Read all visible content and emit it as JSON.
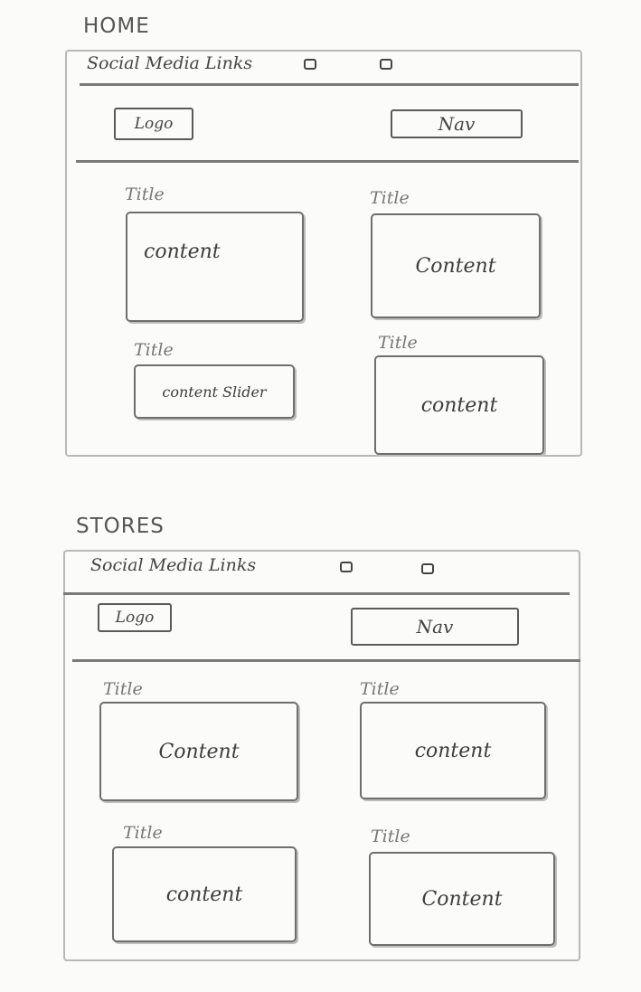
{
  "home": {
    "page_label": "HOME",
    "social_text": "Social Media Links",
    "social_icons": [
      "square-icon",
      "square-icon"
    ],
    "logo": "Logo",
    "nav": "Nav",
    "blocks": [
      {
        "title": "Title",
        "content": "content"
      },
      {
        "title": "Title",
        "content": "Content"
      },
      {
        "title": "Title",
        "content": "content Slider"
      },
      {
        "title": "Title",
        "content": "content"
      }
    ]
  },
  "stores": {
    "page_label": "STORES",
    "social_text": "Social Media Links",
    "social_icons": [
      "square-icon",
      "square-icon"
    ],
    "logo": "Logo",
    "nav": "Nav",
    "blocks": [
      {
        "title": "Title",
        "content": "Content"
      },
      {
        "title": "Title",
        "content": "content"
      },
      {
        "title": "Title",
        "content": "content"
      },
      {
        "title": "Title",
        "content": "Content"
      }
    ]
  }
}
